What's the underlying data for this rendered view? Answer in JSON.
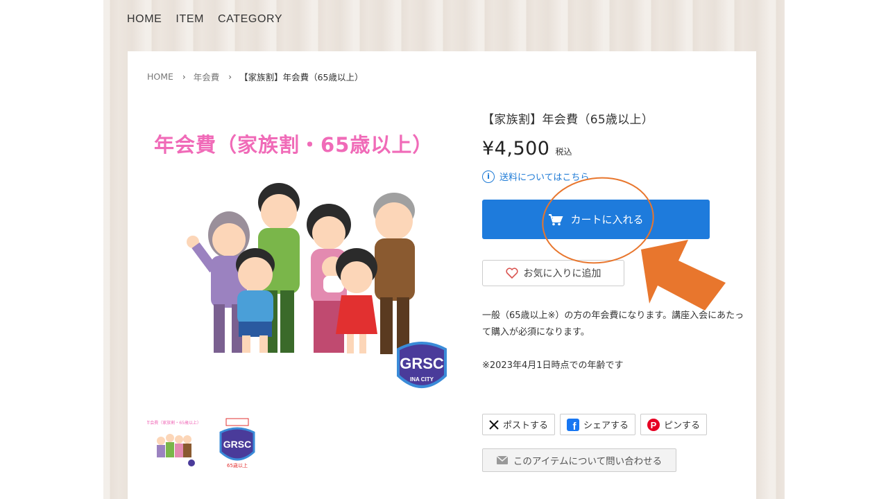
{
  "nav": {
    "items": [
      "HOME",
      "ITEM",
      "CATEGORY"
    ]
  },
  "breadcrumb": {
    "home": "HOME",
    "category": "年会費",
    "current": "【家族割】年会費（65歳以上）"
  },
  "product": {
    "image_title": "年会費（家族割・65歳以上）",
    "logo_text": "GRSC",
    "logo_sub": "INA CITY",
    "title": "【家族割】年会費（65歳以上）",
    "price": "¥4,500",
    "tax_label": "税込",
    "shipping_link": "送料についてはこちら",
    "cart_button": "カートに入れる",
    "favorite_button": "お気に入りに追加",
    "description_line": "一般（65歳以上※）の方の年会費になります。講座入会にあたって購入が必須になります。",
    "note": "※2023年4月1日時点での年齢です"
  },
  "thumbnails": [
    {
      "label": "年会費（家族割・65歳以上）",
      "icon": "family-thumbnail"
    },
    {
      "label": "家族割 65歳以上",
      "icon": "grsc-badge-thumbnail"
    }
  ],
  "share": {
    "post": "ポストする",
    "facebook": "シェアする",
    "pin": "ピンする"
  },
  "contact_button": "このアイテムについて問い合わせる",
  "colors": {
    "accent": "#1e7bdc",
    "annotation": "#e8762d",
    "pink_title": "#f06bb8",
    "badge": "#4a3b9a"
  }
}
